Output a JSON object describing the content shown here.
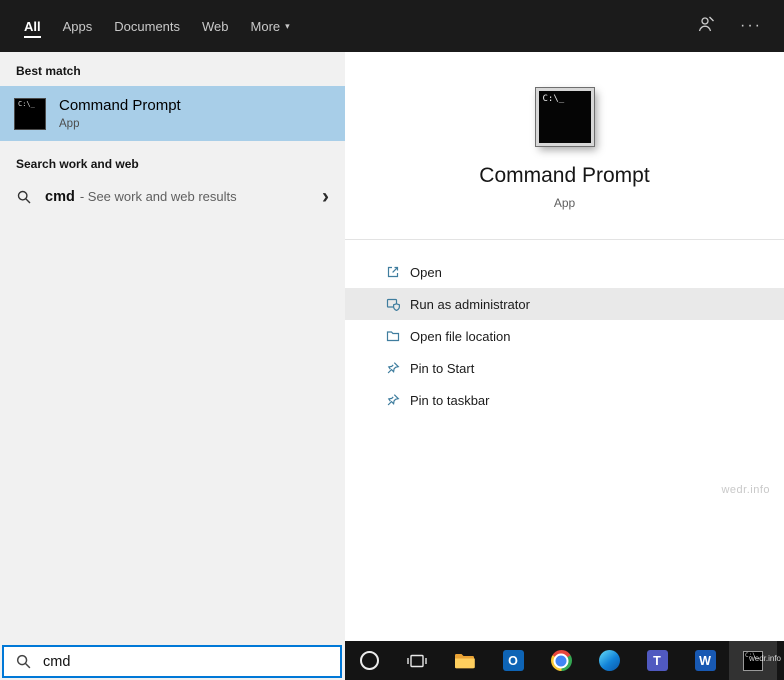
{
  "header": {
    "tabs": [
      {
        "label": "All",
        "active": true
      },
      {
        "label": "Apps",
        "active": false
      },
      {
        "label": "Documents",
        "active": false
      },
      {
        "label": "Web",
        "active": false
      },
      {
        "label": "More",
        "active": false,
        "caret": "▾"
      }
    ],
    "ellipsis_glyph": "···"
  },
  "left_panel": {
    "best_match_header": "Best match",
    "best_match": {
      "title": "Command Prompt",
      "subtitle": "App"
    },
    "search_web_header": "Search work and web",
    "web_suggestion": {
      "query": "cmd",
      "suffix": "- See work and web results",
      "chevron": "›"
    },
    "search_box": {
      "value": "cmd"
    }
  },
  "right_panel": {
    "app_title": "Command Prompt",
    "app_subtitle": "App",
    "icon_glyph": "C:\\_",
    "actions": [
      {
        "label": "Open",
        "highlighted": false
      },
      {
        "label": "Run as administrator",
        "highlighted": true
      },
      {
        "label": "Open file location",
        "highlighted": false
      },
      {
        "label": "Pin to Start",
        "highlighted": false
      },
      {
        "label": "Pin to taskbar",
        "highlighted": false
      }
    ]
  },
  "taskbar": {
    "outlook_glyph": "O",
    "teams_glyph": "T",
    "word_glyph": "W"
  },
  "watermark": "wedr.info",
  "colors": {
    "accent": "#0078d7",
    "best_match_highlight": "#a8cee8",
    "header_bg": "#1b1b1b",
    "action_icon": "#3f7d9e"
  }
}
